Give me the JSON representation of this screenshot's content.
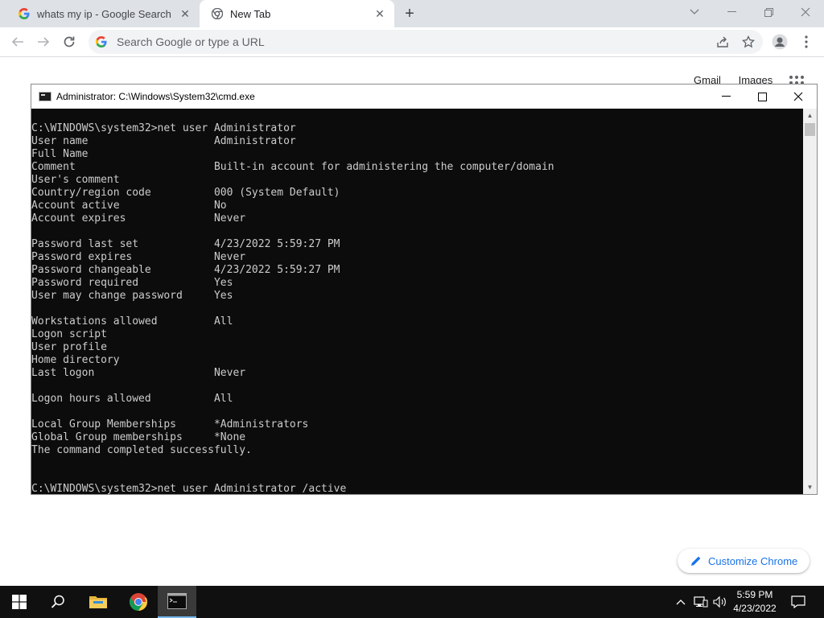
{
  "browser": {
    "tabs": [
      {
        "title": "whats my ip - Google Search",
        "icon": "google-g-icon"
      },
      {
        "title": "New Tab",
        "icon": "chrome-icon"
      }
    ],
    "omnibox_placeholder": "Search Google or type a URL",
    "ntp_links": [
      "Gmail",
      "Images"
    ],
    "customize_label": "Customize Chrome"
  },
  "cmd": {
    "title": "Administrator: C:\\Windows\\System32\\cmd.exe",
    "lines": [
      "C:\\WINDOWS\\system32>net user Administrator",
      "User name                    Administrator",
      "Full Name",
      "Comment                      Built-in account for administering the computer/domain",
      "User's comment",
      "Country/region code          000 (System Default)",
      "Account active               No",
      "Account expires              Never",
      "",
      "Password last set            4/23/2022 5:59:27 PM",
      "Password expires             Never",
      "Password changeable          4/23/2022 5:59:27 PM",
      "Password required            Yes",
      "User may change password     Yes",
      "",
      "Workstations allowed         All",
      "Logon script",
      "User profile",
      "Home directory",
      "Last logon                   Never",
      "",
      "Logon hours allowed          All",
      "",
      "Local Group Memberships      *Administrators",
      "Global Group memberships     *None",
      "The command completed successfully.",
      "",
      "",
      "C:\\WINDOWS\\system32>net user Administrator /active"
    ]
  },
  "taskbar": {
    "time": "5:59 PM",
    "date": "4/23/2022"
  },
  "colors": {
    "terminal_bg": "#0c0c0c",
    "terminal_text": "#cccccc",
    "accent": "#1a73e8",
    "taskbar": "#101010"
  }
}
